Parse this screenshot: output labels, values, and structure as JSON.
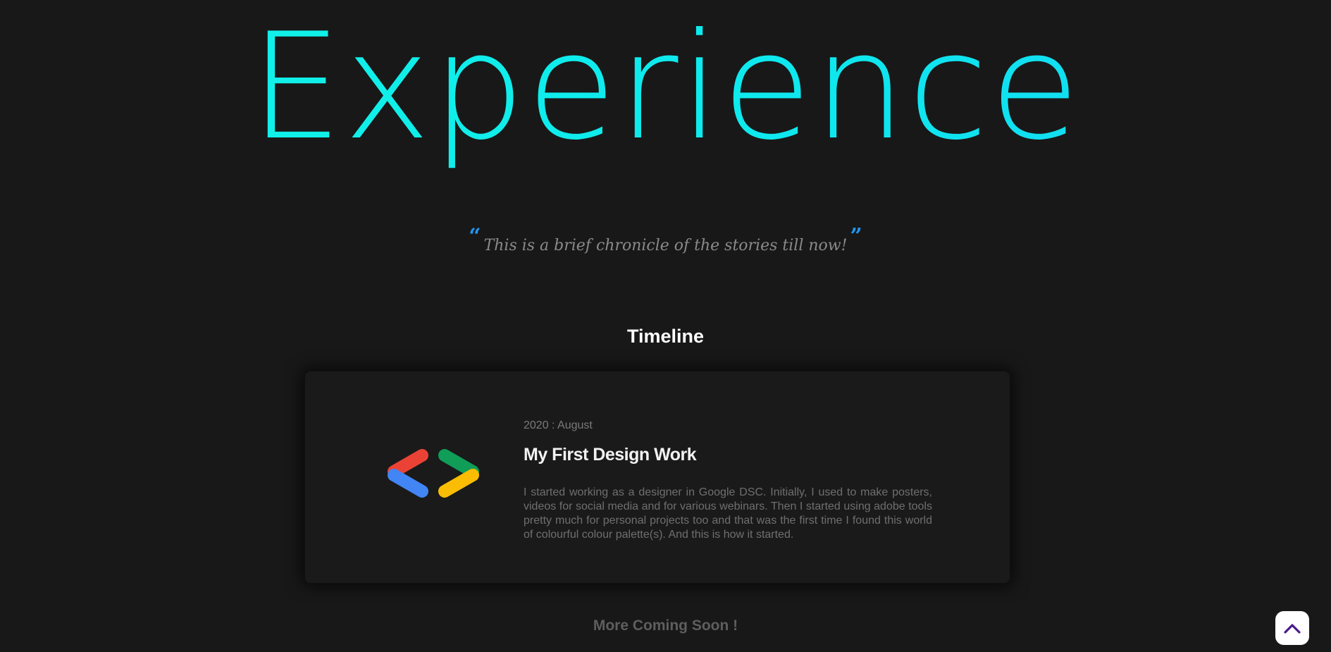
{
  "hero": {
    "title": "Experience"
  },
  "quote": {
    "open_mark": "“",
    "text": "This is a brief chronicle of the stories till now!",
    "close_mark": "”"
  },
  "timeline": {
    "heading": "Timeline",
    "entries": [
      {
        "date": "2020 : August",
        "title": "My First Design Work",
        "description": "I started working as a designer in Google DSC. Initially, I used to make posters, videos for social media and for various webinars. Then I started using adobe tools pretty much for personal projects too and that was the first time I found this world of colourful colour palette(s). And this is how it started.",
        "logo_icon": "google-developers-brackets-icon",
        "logo_colors": [
          "#ea4335",
          "#4285f4",
          "#0f9d58",
          "#fbbc04"
        ]
      }
    ],
    "footer": "More Coming Soon !"
  },
  "scroll_top": {
    "icon": "chevron-up-icon",
    "color": "#4a1a8c"
  },
  "colors": {
    "background": "#181818",
    "title_gradient_start": "#12f5e6",
    "title_gradient_end": "#14d6f3",
    "quote_mark": "#2196f3"
  }
}
